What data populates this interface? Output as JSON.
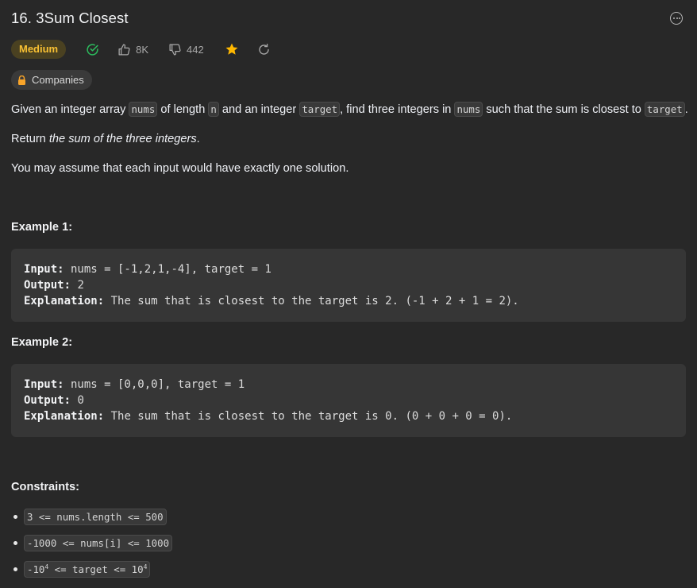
{
  "problem": {
    "title": "16. 3Sum Closest",
    "difficulty": "Medium",
    "likes": "8K",
    "dislikes": "442",
    "companies_label": "Companies"
  },
  "description": {
    "p1": {
      "t1": "Given an integer array ",
      "c1": "nums",
      "t2": " of length ",
      "c2": "n",
      "t3": " and an integer ",
      "c3": "target",
      "t4": ", find three integers in ",
      "c4": "nums",
      "t5": " such that the sum is closest to ",
      "c5": "target",
      "t6": "."
    },
    "p2": {
      "t1": "Return ",
      "em": "the sum of the three integers",
      "t2": "."
    },
    "p3": "You may assume that each input would have exactly one solution."
  },
  "examples": [
    {
      "heading": "Example 1:",
      "input_label": "Input:",
      "input": " nums = [-1,2,1,-4], target = 1",
      "output_label": "Output:",
      "output": " 2",
      "explanation_label": "Explanation:",
      "explanation": " The sum that is closest to the target is 2. (-1 + 2 + 1 = 2)."
    },
    {
      "heading": "Example 2:",
      "input_label": "Input:",
      "input": " nums = [0,0,0], target = 1",
      "output_label": "Output:",
      "output": " 0",
      "explanation_label": "Explanation:",
      "explanation": " The sum that is closest to the target is 0. (0 + 0 + 0 = 0)."
    }
  ],
  "constraints": {
    "heading": "Constraints:",
    "c1": "3 <= nums.length <= 500",
    "c2": "-1000 <= nums[i] <= 1000",
    "c3": {
      "a": "-10",
      "a_exp": "4",
      "b": " <= target <= 10",
      "b_exp": "4"
    }
  },
  "colors": {
    "background": "#282828",
    "difficulty_medium": "#f8c033",
    "solved_check": "#2cbb5d",
    "favorite_star": "#ffb800"
  },
  "icons": [
    "more-options-icon",
    "solved-check-icon",
    "thumbs-up-icon",
    "thumbs-down-icon",
    "star-icon",
    "share-icon",
    "lock-icon"
  ]
}
